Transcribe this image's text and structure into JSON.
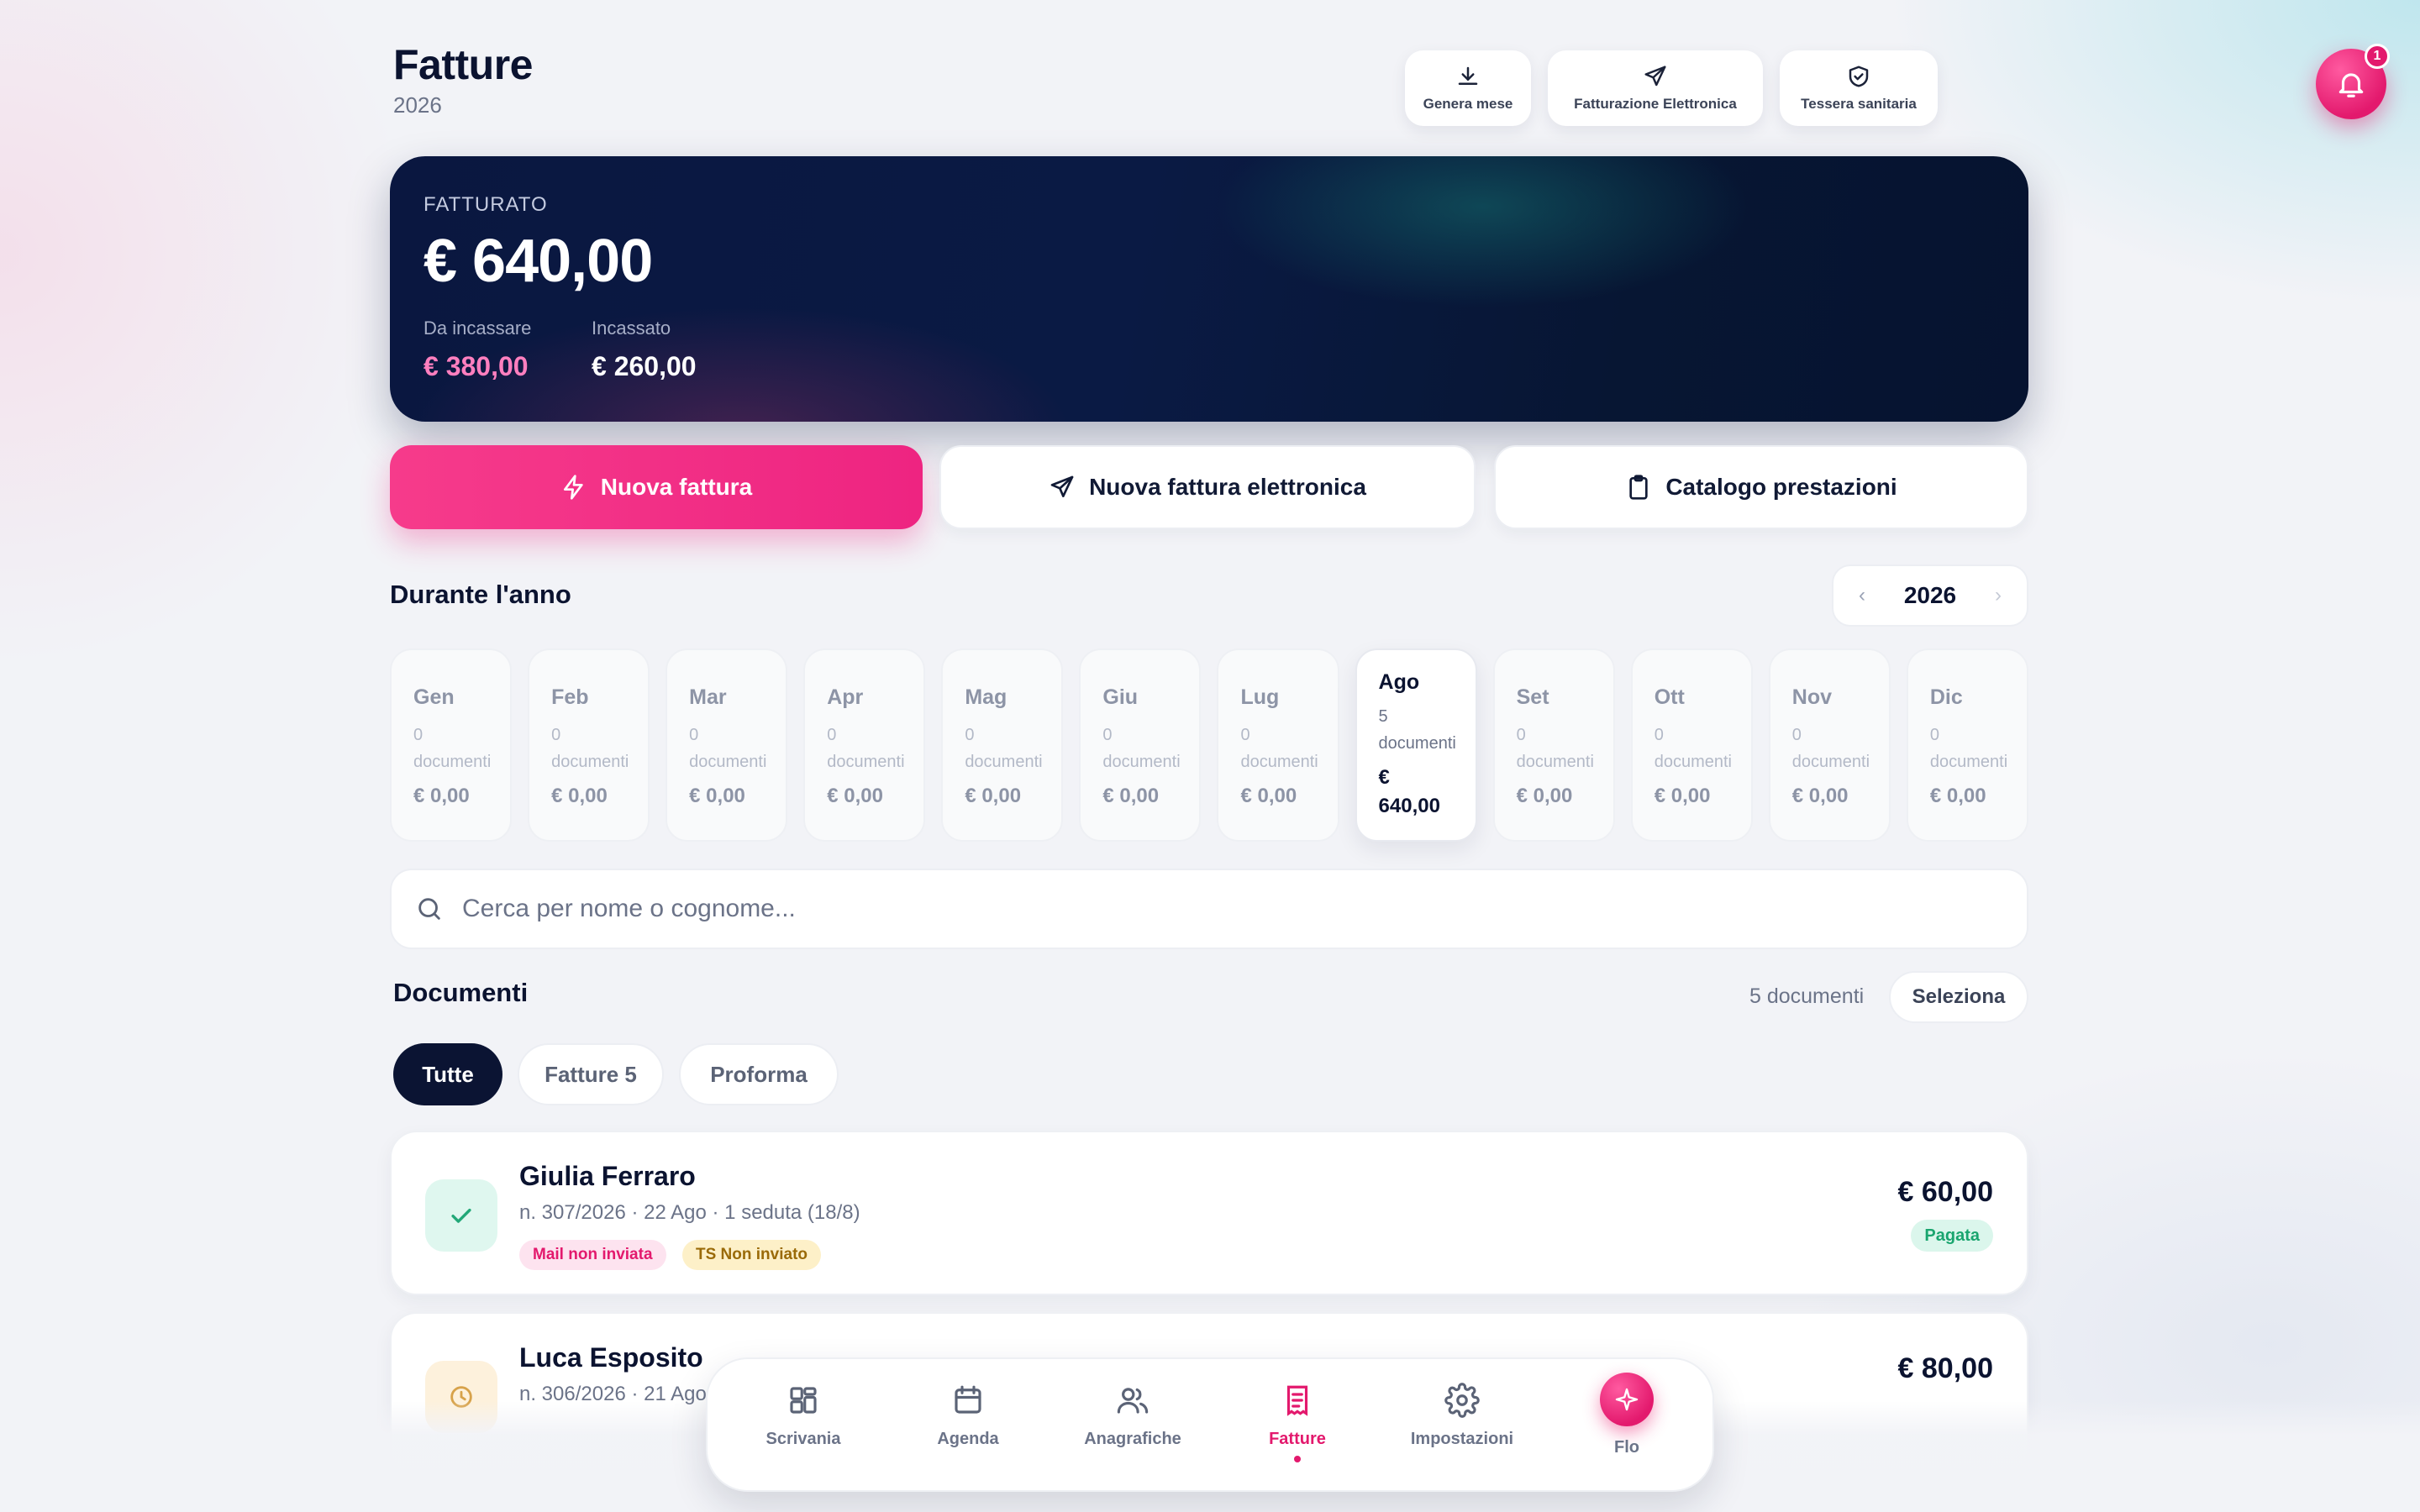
{
  "header": {
    "title": "Fatture",
    "year": "2026",
    "actions": [
      {
        "label": "Genera mese",
        "icon": "download-icon"
      },
      {
        "label": "Fatturazione Elettronica",
        "icon": "send-icon"
      },
      {
        "label": "Tessera sanitaria",
        "icon": "shield-check-icon"
      }
    ],
    "notifications_count": "1"
  },
  "summary": {
    "label": "FATTURATO",
    "total": "€ 640,00",
    "to_collect_label": "Da incassare",
    "to_collect_value": "€ 380,00",
    "collected_label": "Incassato",
    "collected_value": "€ 260,00",
    "colors": {
      "to_collect": "#ff7fbf",
      "collected": "#ffffff"
    }
  },
  "quick_actions": {
    "new_invoice": "Nuova fattura",
    "new_e_invoice": "Nuova fattura elettronica",
    "catalog": "Catalogo prestazioni"
  },
  "year_section": {
    "title": "Durante l'anno",
    "year": "2026",
    "prev_arrow": "‹",
    "next_arrow": "›",
    "months": [
      {
        "name": "Gen",
        "count": "0",
        "count_label": "documenti",
        "amount": "€ 0,00"
      },
      {
        "name": "Feb",
        "count": "0",
        "count_label": "documenti",
        "amount": "€ 0,00"
      },
      {
        "name": "Mar",
        "count": "0",
        "count_label": "documenti",
        "amount": "€ 0,00"
      },
      {
        "name": "Apr",
        "count": "0",
        "count_label": "documenti",
        "amount": "€ 0,00"
      },
      {
        "name": "Mag",
        "count": "0",
        "count_label": "documenti",
        "amount": "€ 0,00"
      },
      {
        "name": "Giu",
        "count": "0",
        "count_label": "documenti",
        "amount": "€ 0,00"
      },
      {
        "name": "Lug",
        "count": "0",
        "count_label": "documenti",
        "amount": "€ 0,00"
      },
      {
        "name": "Ago",
        "count": "5",
        "count_label": "documenti",
        "amount_line1": "€",
        "amount_line2": "640,00",
        "selected": true
      },
      {
        "name": "Set",
        "count": "0",
        "count_label": "documenti",
        "amount": "€ 0,00"
      },
      {
        "name": "Ott",
        "count": "0",
        "count_label": "documenti",
        "amount": "€ 0,00"
      },
      {
        "name": "Nov",
        "count": "0",
        "count_label": "documenti",
        "amount": "€ 0,00"
      },
      {
        "name": "Dic",
        "count": "0",
        "count_label": "documenti",
        "amount": "€ 0,00"
      }
    ]
  },
  "search": {
    "placeholder": "Cerca per nome o cognome...",
    "value": ""
  },
  "documents": {
    "title": "Documenti",
    "count_text": "5 documenti",
    "select_label": "Seleziona",
    "filters": [
      {
        "label": "Tutte",
        "active": true
      },
      {
        "label": "Fatture 5"
      },
      {
        "label": "Proforma"
      }
    ],
    "rows": [
      {
        "name": "Giulia Ferraro",
        "meta": "n. 307/2026 · 22 Ago · 1 seduta (18/8)",
        "tags": [
          "Mail non inviata",
          "TS Non inviato"
        ],
        "amount": "€ 60,00",
        "status": "Pagata",
        "status_icon": "check-icon"
      },
      {
        "name": "Luca Esposito",
        "meta": "n. 306/2026 · 21 Ago",
        "amount": "€ 80,00",
        "status_icon": "clock-icon"
      }
    ]
  },
  "nav": {
    "items": [
      {
        "label": "Scrivania",
        "icon": "grid-icon"
      },
      {
        "label": "Agenda",
        "icon": "calendar-icon"
      },
      {
        "label": "Anagrafiche",
        "icon": "users-icon"
      },
      {
        "label": "Fatture",
        "icon": "invoice-icon",
        "active": true
      },
      {
        "label": "Impostazioni",
        "icon": "gear-icon"
      },
      {
        "label": "Flo",
        "icon": "sparkle-icon"
      }
    ],
    "accent": "#e3196d"
  }
}
